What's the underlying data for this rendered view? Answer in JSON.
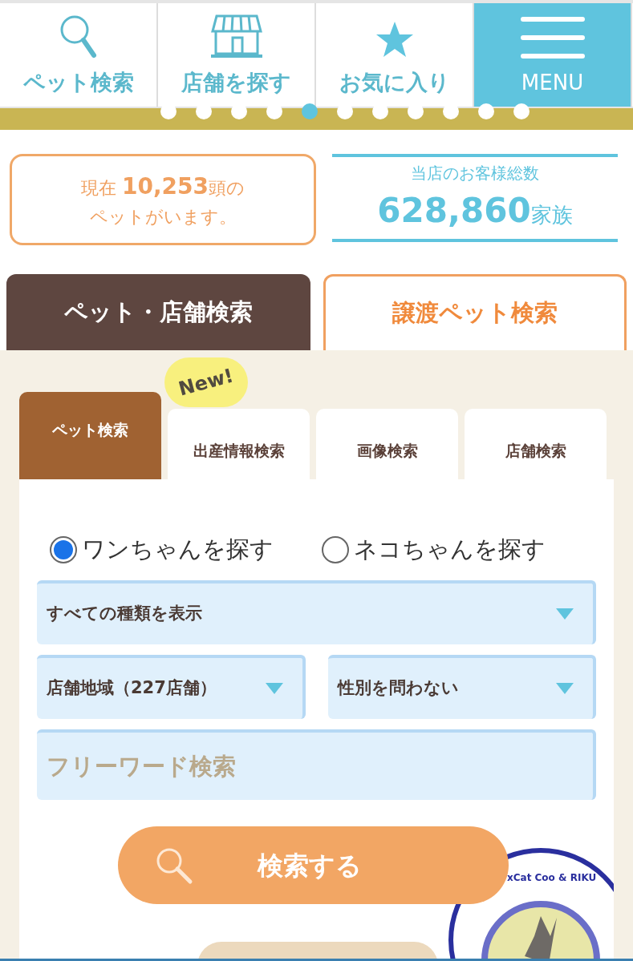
{
  "nav": [
    {
      "kind": "search",
      "label": "ペット検索",
      "selected": false
    },
    {
      "kind": "shop",
      "label": "店舗を探す",
      "selected": false
    },
    {
      "kind": "star",
      "label": "お気に入り",
      "selected": false
    },
    {
      "kind": "menu",
      "label": "MENU",
      "selected": true
    }
  ],
  "carousel": {
    "dots": [
      false,
      false,
      false,
      false,
      true,
      false,
      false,
      false,
      false,
      false,
      false
    ]
  },
  "stats": {
    "pets": {
      "prefix": "現在 ",
      "count": "10,253",
      "suffix": "頭の",
      "line2": "ペットがいます。"
    },
    "customers": {
      "label": "当店のお客様総数",
      "count": "628,860",
      "unit": "家族"
    }
  },
  "main_tabs": [
    {
      "label": "ペット・店舗検索",
      "selected": true
    },
    {
      "label": "譲渡ペット検索",
      "selected": false
    }
  ],
  "sub_tabs": [
    {
      "label": "ペット検索",
      "selected": true
    },
    {
      "label": "出産情報検索",
      "selected": false,
      "badge": "New!"
    },
    {
      "label": "画像検索",
      "selected": false
    },
    {
      "label": "店舗検索",
      "selected": false
    }
  ],
  "radios": [
    {
      "label": "ワンちゃんを探す",
      "selected": true
    },
    {
      "label": "ネコちゃんを探す",
      "selected": false
    }
  ],
  "selects": [
    {
      "value": "すべての種類を表示"
    },
    {
      "value": "店舗地域（227店舗）"
    },
    {
      "value": "性別を問わない"
    }
  ],
  "freeword": {
    "placeholder": "フリーワード検索"
  },
  "search_button": "検索する",
  "badge_logo": {
    "text": "xCat Coo & RIKU"
  }
}
